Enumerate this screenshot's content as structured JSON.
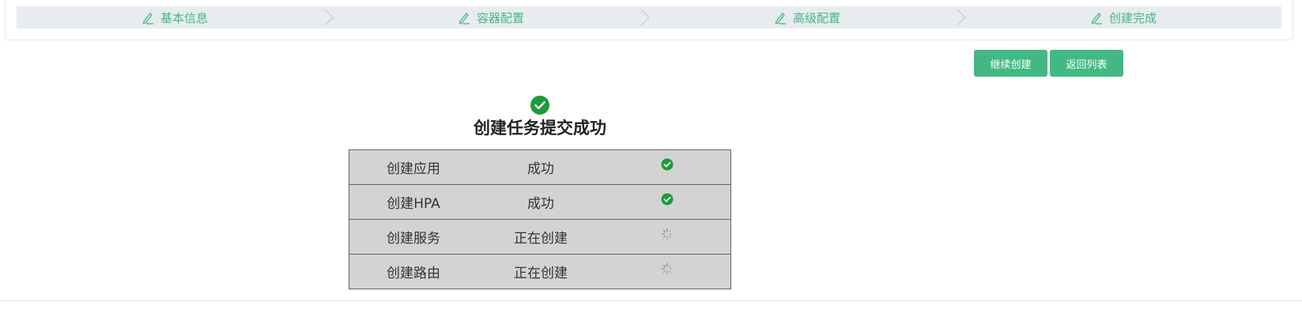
{
  "steps": [
    {
      "label": "基本信息",
      "icon": "pencil-icon"
    },
    {
      "label": "容器配置",
      "icon": "pencil-icon"
    },
    {
      "label": "高级配置",
      "icon": "pencil-icon"
    },
    {
      "label": "创建完成",
      "icon": "pencil-icon"
    }
  ],
  "buttons": {
    "continue": "继续创建",
    "back": "返回列表"
  },
  "result": {
    "title": "创建任务提交成功",
    "icon": "check-circle-icon"
  },
  "tasks": [
    {
      "name": "创建应用",
      "status": "成功",
      "state_icon": "check-circle-icon"
    },
    {
      "name": "创建HPA",
      "status": "成功",
      "state_icon": "check-circle-icon"
    },
    {
      "name": "创建服务",
      "status": "正在创建",
      "state_icon": "spinner-icon"
    },
    {
      "name": "创建路由",
      "status": "正在创建",
      "state_icon": "spinner-icon"
    }
  ],
  "colors": {
    "accent": "#42b983",
    "success": "#1a9c36",
    "table_bg": "#d3d3d3",
    "steps_bg": "#e8ebef"
  }
}
